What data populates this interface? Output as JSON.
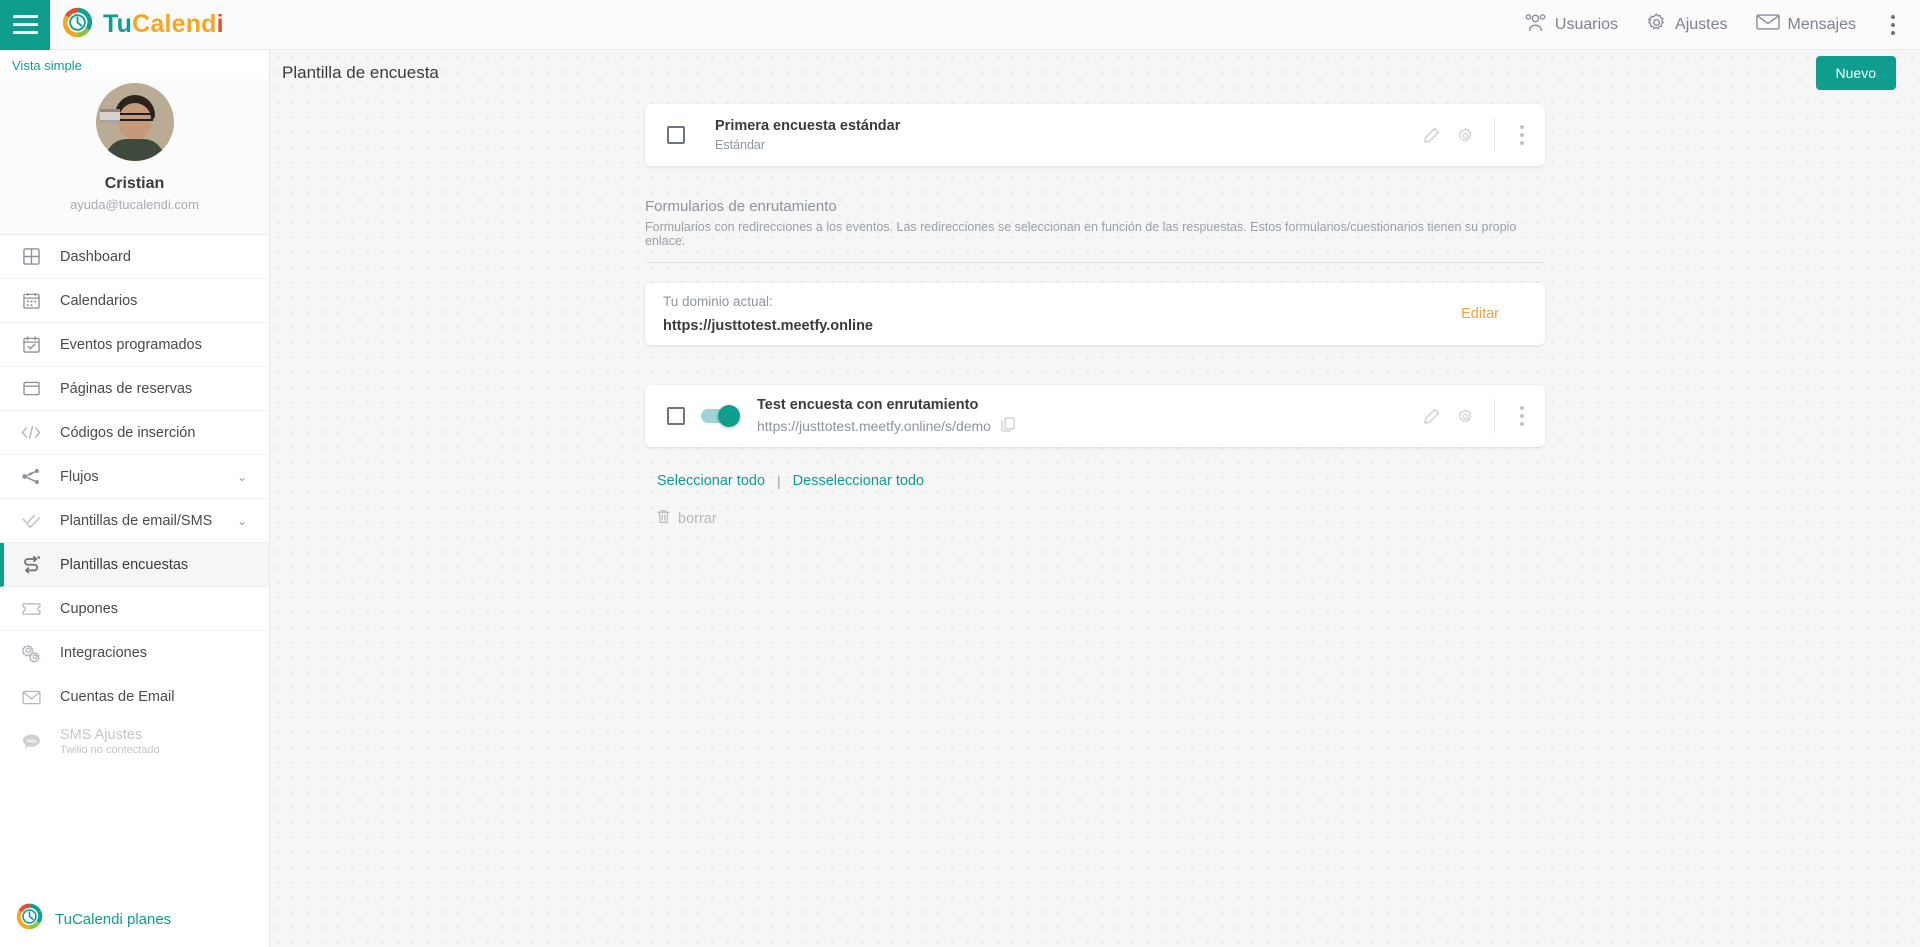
{
  "topbar": {
    "menu_icon": "hamburger-icon",
    "brand": {
      "part1": "Tu",
      "part2": "Calend",
      "part3": "i"
    },
    "items": [
      {
        "label": "Usuarios",
        "icon": "users-icon"
      },
      {
        "label": "Ajustes",
        "icon": "gear-icon"
      },
      {
        "label": "Mensajes",
        "icon": "envelope-icon"
      }
    ],
    "overflow_icon": "kebab-menu-icon"
  },
  "sidebar": {
    "view_toggle": "Vista simple",
    "profile": {
      "name": "Cristian",
      "email": "ayuda@tucalendi.com",
      "avatar": "user-avatar"
    },
    "items": [
      {
        "label": "Dashboard",
        "icon": "grid-icon",
        "chevron": "",
        "active": false
      },
      {
        "label": "Calendarios",
        "icon": "calendar-icon",
        "chevron": "",
        "active": false
      },
      {
        "label": "Eventos programados",
        "icon": "calendar-check-icon",
        "chevron": "",
        "active": false
      },
      {
        "label": "Páginas de reservas",
        "icon": "window-icon",
        "chevron": "",
        "active": false
      },
      {
        "label": "Códigos de inserción",
        "icon": "code-icon",
        "chevron": "",
        "active": false
      },
      {
        "label": "Flujos",
        "icon": "flow-icon",
        "chevron": "⌄",
        "active": false
      },
      {
        "label": "Plantillas de email/SMS",
        "icon": "double-check-icon",
        "chevron": "⌄",
        "active": false
      },
      {
        "label": "Plantillas encuestas",
        "icon": "survey-icon",
        "chevron": "",
        "active": true
      },
      {
        "label": "Cupones",
        "icon": "ticket-icon",
        "chevron": "",
        "active": false
      },
      {
        "label": "Integraciones",
        "icon": "gears-icon",
        "chevron": "",
        "active": false
      },
      {
        "label": "Cuentas de Email",
        "icon": "envelope-icon",
        "chevron": "",
        "active": false
      },
      {
        "label": "SMS Ajustes",
        "sublabel": "Twilio no contectado",
        "icon": "sms-icon",
        "chevron": "",
        "active": false,
        "disabled": true
      }
    ],
    "footer": {
      "label": "TuCalendi planes",
      "icon": "tucalendi-logo-icon"
    }
  },
  "main": {
    "page_title": "Plantilla de encuesta",
    "new_button": "Nuevo",
    "standard_survey": {
      "title": "Primera encuesta estándar",
      "subtitle": "Estándar",
      "edit_icon": "pencil-icon",
      "settings_icon": "gear-icon",
      "more_icon": "kebab-menu-icon"
    },
    "routing": {
      "title": "Formularios de enrutamiento",
      "description": "Formularios con redirecciones a los eventos. Las redirecciones se seleccionan en función de las respuestas. Estos formularios/cuestionarios tienen su propio enlace."
    },
    "domain_card": {
      "label": "Tu dominio actual:",
      "value": "https://justtotest.meetfy.online",
      "edit_link": "Editar"
    },
    "routing_survey": {
      "title": "Test encuesta con enrutamiento",
      "url": "https://justtotest.meetfy.online/s/demo",
      "copy_icon": "copy-icon",
      "toggle_state": "on",
      "edit_icon": "pencil-icon",
      "settings_icon": "gear-icon",
      "more_icon": "kebab-menu-icon"
    },
    "selection": {
      "select_all": "Seleccionar todo",
      "separator": "|",
      "deselect_all": "Desseleccionar todo",
      "delete_label": "borrar",
      "delete_icon": "trash-icon"
    }
  },
  "colors": {
    "brand_teal": "#0f9e8e",
    "brand_amber": "#f5a623",
    "brand_orange": "#e8502a",
    "edit_link": "#f0a342"
  }
}
